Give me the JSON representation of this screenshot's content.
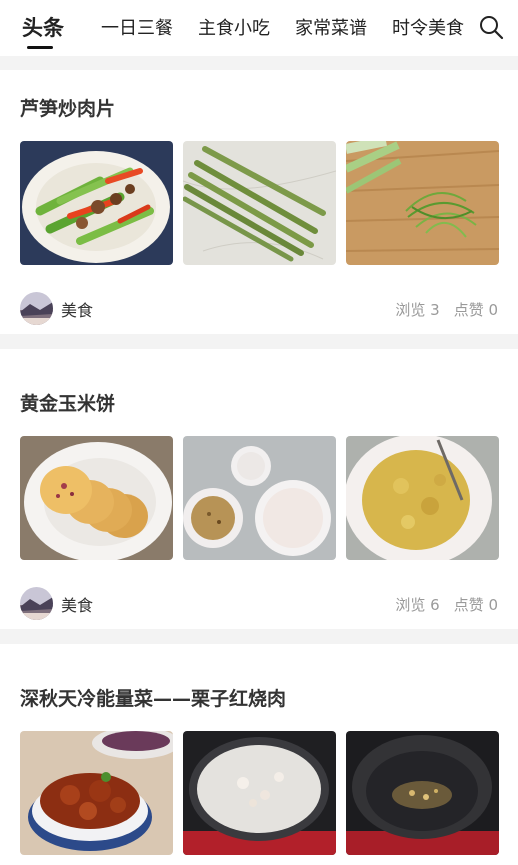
{
  "nav": {
    "tabs": [
      {
        "label": "头条",
        "active": true
      },
      {
        "label": "一日三餐"
      },
      {
        "label": "主食小吃"
      },
      {
        "label": "家常菜谱"
      },
      {
        "label": "时令美食"
      }
    ],
    "search_icon": "search-icon"
  },
  "articles": [
    {
      "title": "芦笋炒肉片",
      "author": "美食",
      "views_label": "浏览 3",
      "likes_label": "点赞 0",
      "images": [
        "stir-fried-asparagus-pork",
        "raw-asparagus",
        "shredded-scallion"
      ]
    },
    {
      "title": "黄金玉米饼",
      "author": "美食",
      "views_label": "浏览 6",
      "likes_label": "点赞 0",
      "images": [
        "corn-pancakes-on-plate",
        "bowls-of-flour-and-grains",
        "mixed-corn-batter"
      ]
    },
    {
      "title": "深秋天冷能量菜——栗子红烧肉",
      "author": "美食",
      "images": [
        "braised-pork-with-chestnuts",
        "pot-of-boiling-pork",
        "pot-with-oil-and-garlic"
      ]
    }
  ]
}
